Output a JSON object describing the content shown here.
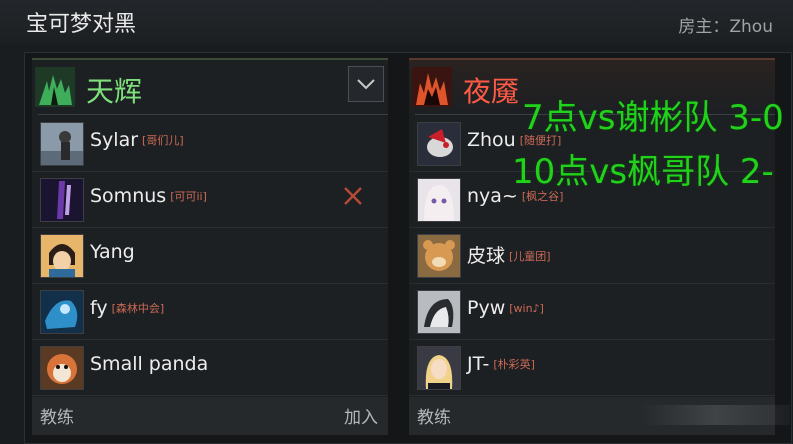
{
  "lobby": {
    "title": "宝可梦对黑",
    "host_label": "房主：Zhou"
  },
  "radiant": {
    "name": "天辉",
    "icon": "radiant-tree-icon",
    "color": "#7ee07a",
    "players": [
      {
        "name": "Sylar",
        "tag": "[哥们儿]"
      },
      {
        "name": "Somnus",
        "tag": "[可可ii]"
      },
      {
        "name": "Yang",
        "tag": ""
      },
      {
        "name": "fy",
        "tag": "[森林中会]"
      },
      {
        "name": "Small panda",
        "tag": ""
      }
    ],
    "coach_label": "教练",
    "join_label": "加入"
  },
  "dire": {
    "name": "夜魇",
    "icon": "dire-fire-icon",
    "color": "#ff5a46",
    "players": [
      {
        "name": "Zhou",
        "tag": "[随便打]"
      },
      {
        "name": "nya~",
        "tag": "[枫之谷]"
      },
      {
        "name": "皮球",
        "tag": "[儿童团]"
      },
      {
        "name": "Pyw",
        "tag": "[win♪]"
      },
      {
        "name": "JT-",
        "tag": "[朴彩英]"
      }
    ],
    "coach_label": "教练"
  },
  "overlay": {
    "line1": "7点vs谢彬队 3-0",
    "line2": "10点vs枫哥队 2-",
    "color": "#22d11c"
  }
}
